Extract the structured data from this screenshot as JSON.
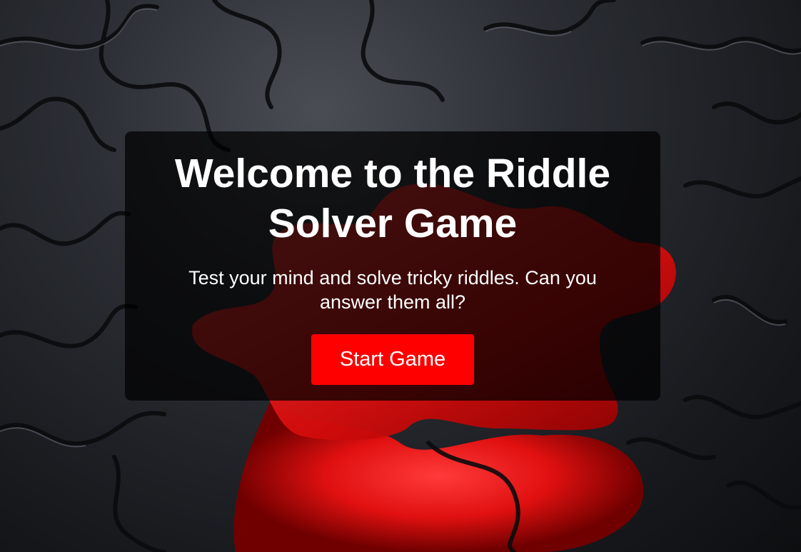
{
  "welcome": {
    "title": "Welcome to the Riddle Solver Game",
    "subtitle": "Test your mind and solve tricky riddles. Can you answer them all?",
    "start_button_label": "Start Game"
  },
  "background": {
    "image": "puzzle-pieces-background",
    "accent_color": "#ff1a1a",
    "base_color": "#1b1d21"
  },
  "colors": {
    "button": "#ff0000",
    "card_overlay": "rgba(0,0,0,0.72)",
    "text": "#ffffff"
  }
}
